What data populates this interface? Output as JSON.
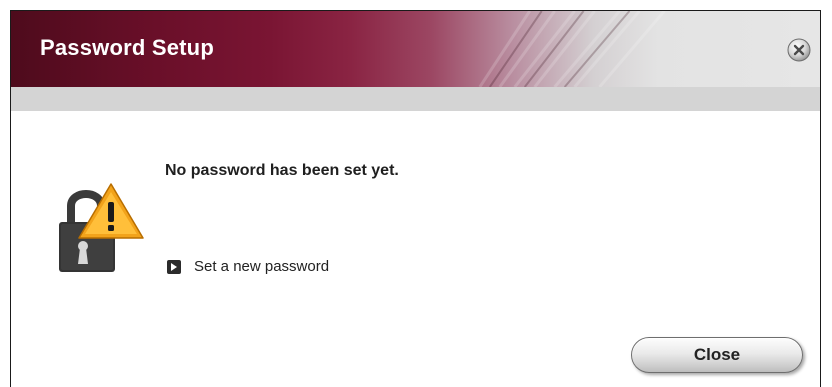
{
  "window": {
    "title": "Password Setup"
  },
  "body": {
    "message": "No password has been set yet.",
    "set_password_link": "Set a new password"
  },
  "footer": {
    "close_label": "Close"
  },
  "icons": {
    "close": "close-circle-icon",
    "status": "lock-warning-icon",
    "link": "arrow-right-box-icon"
  },
  "colors": {
    "title_bar_dark": "#5a0c22",
    "title_text": "#ffffff",
    "warning": "#f5a623"
  }
}
